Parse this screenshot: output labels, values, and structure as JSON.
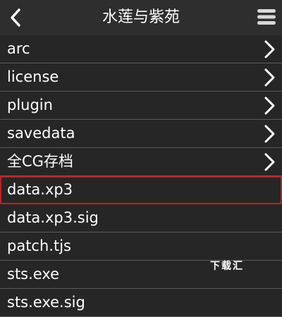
{
  "header": {
    "title": "水莲与紫苑",
    "back_icon": "chevron-left-icon",
    "menu_icon": "hamburger-menu-icon"
  },
  "items": [
    {
      "label": "arc",
      "folder": true
    },
    {
      "label": "license",
      "folder": true
    },
    {
      "label": "plugin",
      "folder": true
    },
    {
      "label": "savedata",
      "folder": true
    },
    {
      "label": "全CG存档",
      "folder": true
    },
    {
      "label": "data.xp3",
      "folder": false,
      "selected": true
    },
    {
      "label": "data.xp3.sig",
      "folder": false
    },
    {
      "label": "patch.tjs",
      "folder": false
    },
    {
      "label": "sts.exe",
      "folder": false
    },
    {
      "label": "sts.exe.sig",
      "folder": false
    }
  ],
  "watermark": "下载汇",
  "colors": {
    "background": "#262626",
    "header": "#2e2e2e",
    "divider": "#5a5a5a",
    "selection_border": "#b0272b",
    "text": "#ffffff"
  }
}
